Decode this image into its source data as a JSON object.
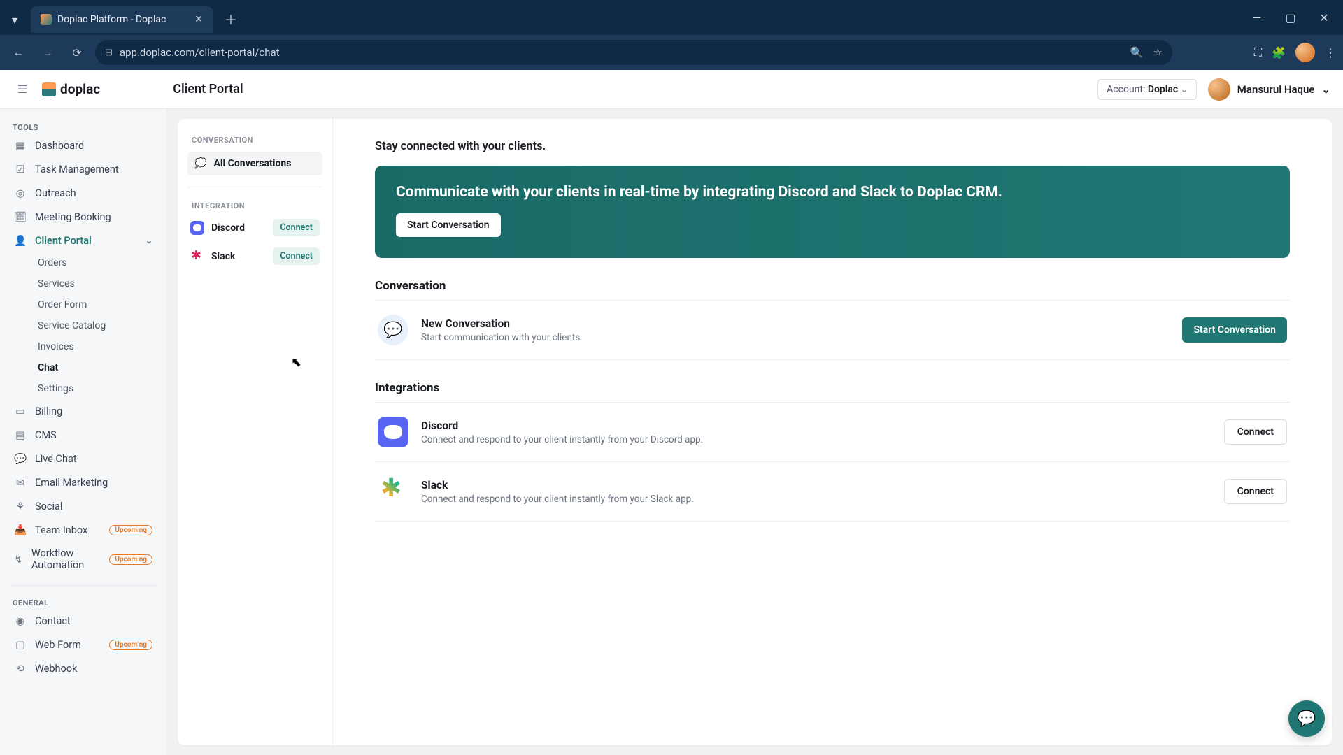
{
  "browser": {
    "tab_title": "Doplac Platform - Doplac",
    "url": "app.doplac.com/client-portal/chat"
  },
  "header": {
    "brand": "doplac",
    "page_title": "Client Portal",
    "account_label": "Account:",
    "account_value": "Doplac",
    "user_name": "Mansurul Haque"
  },
  "sidebar": {
    "section_tools": "TOOLS",
    "section_general": "GENERAL",
    "items": {
      "dashboard": "Dashboard",
      "task": "Task Management",
      "outreach": "Outreach",
      "meeting": "Meeting Booking",
      "client_portal": "Client Portal",
      "billing": "Billing",
      "cms": "CMS",
      "livechat": "Live Chat",
      "email": "Email Marketing",
      "social": "Social",
      "team_inbox": "Team Inbox",
      "workflow": "Workflow Automation",
      "contact": "Contact",
      "webform": "Web Form",
      "webhook": "Webhook"
    },
    "client_portal_sub": {
      "orders": "Orders",
      "services": "Services",
      "order_form": "Order Form",
      "catalog": "Service Catalog",
      "invoices": "Invoices",
      "chat": "Chat",
      "settings": "Settings"
    },
    "badge_upcoming": "Upcoming"
  },
  "conv_sidebar": {
    "label_conv": "CONVERSATION",
    "all_conv": "All Conversations",
    "label_int": "INTEGRATION",
    "discord": "Discord",
    "slack": "Slack",
    "connect": "Connect"
  },
  "main": {
    "lead": "Stay connected with your clients.",
    "hero_title": "Communicate with your clients in real-time by integrating Discord and Slack to Doplac CRM.",
    "hero_cta": "Start Conversation",
    "section_conversation": "Conversation",
    "section_integrations": "Integrations",
    "new_conv_title": "New Conversation",
    "new_conv_sub": "Start communication with your clients.",
    "start_btn": "Start Conversation",
    "discord_title": "Discord",
    "discord_sub": "Connect and respond to your client instantly from your Discord app.",
    "slack_title": "Slack",
    "slack_sub": "Connect and respond to your client instantly from your Slack app.",
    "connect_btn": "Connect"
  }
}
